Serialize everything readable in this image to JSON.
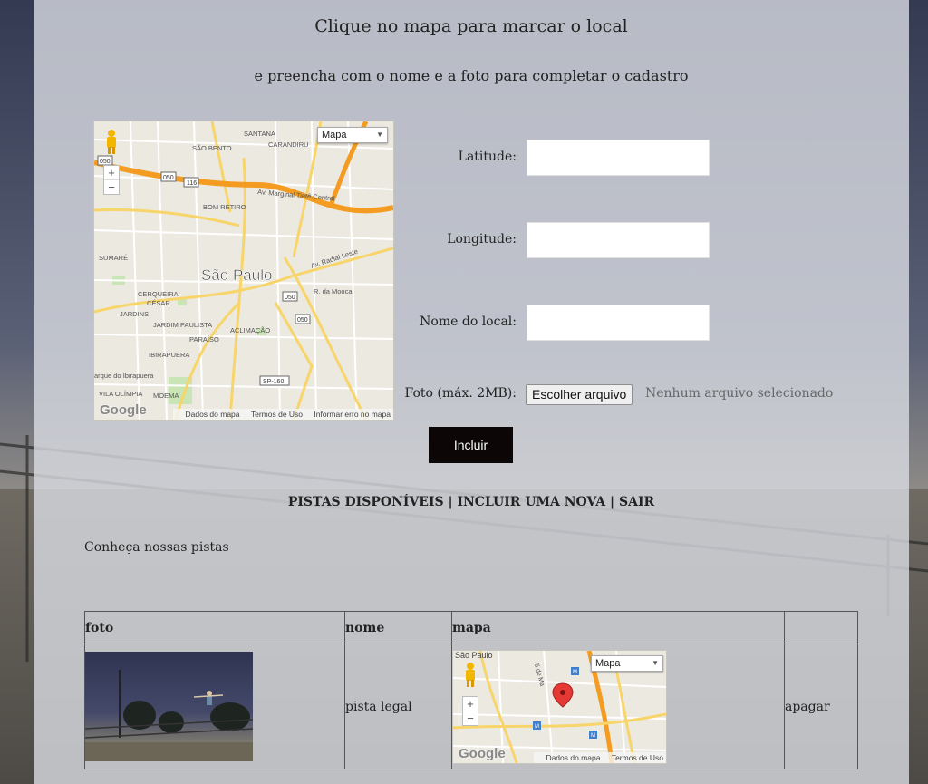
{
  "header": {
    "title": "Clique no mapa para marcar o local",
    "subtitle": "e preencha com o nome e a foto para completar o cadastro"
  },
  "map_main": {
    "type_selector": "Mapa",
    "city_label": "São Paulo",
    "places": [
      "SÃO BENTO",
      "SANTANA",
      "CARANDIRU",
      "BOM RETIRO",
      "SUMARÉ",
      "CERQUEIRA CÉSAR",
      "JARDINS",
      "JARDIM PAULISTA",
      "PARAÍSO",
      "ACLIMAÇÃO",
      "IBIRAPUERA",
      "VILA OLÍMPIA",
      "MOEMA",
      "Av. Marginal Tietê Central",
      "Av. Radial Leste",
      "R. da Mooca",
      "arque do Ibirapuera"
    ],
    "highway_shields": [
      "050",
      "050",
      "116",
      "050",
      "050",
      "SP-160"
    ],
    "footer": [
      "Dados do mapa",
      "Termos de Uso",
      "Informar erro no mapa"
    ],
    "logo": "Google",
    "zoom": [
      "+",
      "−"
    ]
  },
  "form": {
    "latitude_label": "Latitude:",
    "latitude_value": "",
    "longitude_label": "Longitude:",
    "longitude_value": "",
    "name_label": "Nome do local:",
    "name_value": "",
    "photo_label": "Foto (máx. 2MB):",
    "file_button": "Escolher arquivo",
    "file_status": "Nenhum arquivo selecionado",
    "submit": "Incluir"
  },
  "nav": {
    "items": [
      "PISTAS DISPONÍVEIS",
      "INCLUIR UMA NOVA",
      "SAIR"
    ],
    "separator": " | "
  },
  "intro": "Conheça nossas pistas",
  "table": {
    "headers": [
      "foto",
      "nome",
      "mapa",
      ""
    ],
    "rows": [
      {
        "nome": "pista legal",
        "mapa": {
          "type_selector": "Mapa",
          "place": "São Paulo",
          "road": "5 de Ma",
          "footer": [
            "Dados do mapa",
            "Termos de Uso"
          ],
          "logo": "Google",
          "zoom": [
            "+",
            "−"
          ]
        },
        "action": "apagar"
      }
    ]
  },
  "colors": {
    "panel": "#dadce2",
    "button": "#0c0606",
    "road_major": "#f39c21",
    "road_minor": "#f7d56a",
    "marker": "#e53935"
  }
}
